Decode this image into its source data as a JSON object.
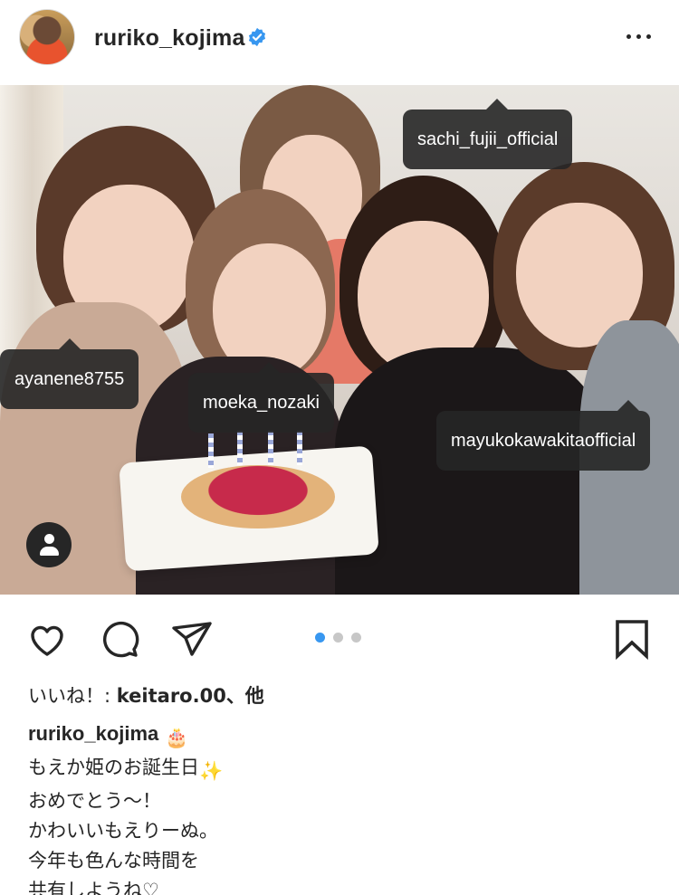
{
  "post": {
    "username": "ruriko_kojima",
    "verified": true,
    "more_icon": "more-horizontal-icon"
  },
  "tags": {
    "t1": "sachi_fujii_official",
    "t2": "ayanene8755",
    "t3": "moeka_nozaki",
    "t4": "mayukokawakitaofficial"
  },
  "carousel": {
    "total": 3,
    "active": 1
  },
  "actions": {
    "like_icon": "heart-icon",
    "comment_icon": "comment-icon",
    "share_icon": "paper-plane-icon",
    "save_icon": "bookmark-icon",
    "user_tag_icon": "person-icon"
  },
  "likes": {
    "prefix": "いいね！: ",
    "user": "keitaro.00",
    "suffix": "、他"
  },
  "caption": {
    "username": "ruriko_kojima",
    "line1_emoji": "🎂",
    "line2": "もえか姫のお誕生日",
    "line2_emoji": "✨",
    "line3": "おめでとう〜！",
    "line4": "かわいいもえりーぬ。",
    "line5": "今年も色んな時間を",
    "line6": "共有しようね♡"
  },
  "colors": {
    "accent": "#3897f0",
    "text": "#262626",
    "inactive_dot": "#c7c7c7"
  }
}
